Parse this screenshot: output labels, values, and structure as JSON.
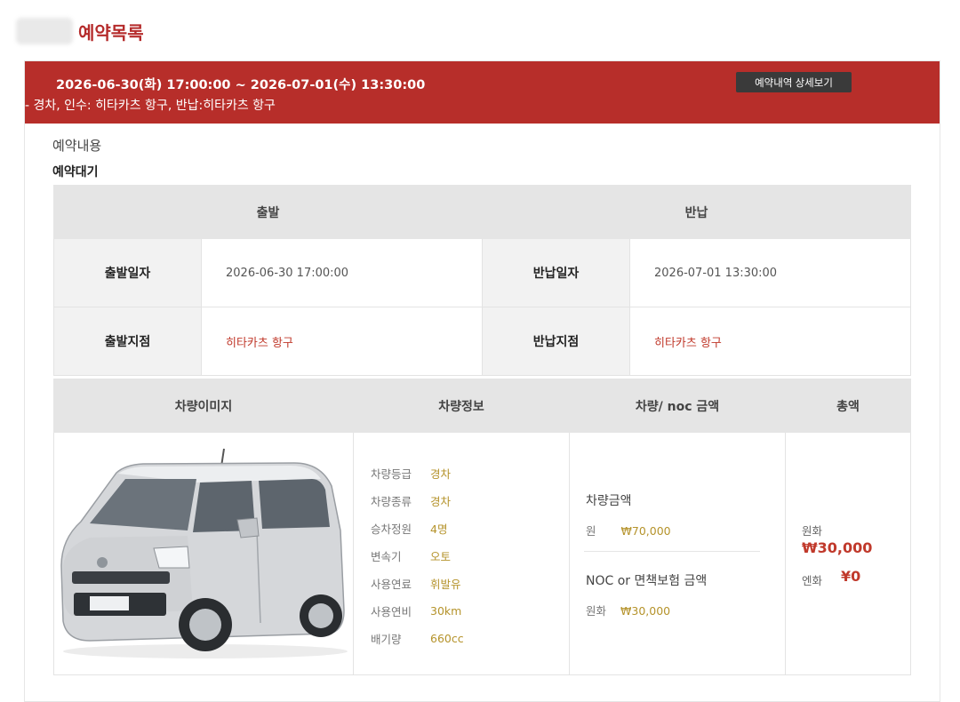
{
  "page": {
    "title": "예약목록"
  },
  "reservation": {
    "period": "2026-06-30(화) 17:00:00 ~ 2026-07-01(수) 13:30:00",
    "summary": "- 경차, 인수: 히타카츠 항구, 반납:히타카츠 항구",
    "detail_button": "예약내역 상세보기",
    "section_label": "예약내용",
    "status": "예약대기"
  },
  "schedule": {
    "departure_header": "출발",
    "return_header": "반납",
    "rows": [
      {
        "dep_label": "출발일자",
        "dep_value": "2026-06-30 17:00:00",
        "ret_label": "반납일자",
        "ret_value": "2026-07-01 13:30:00"
      },
      {
        "dep_label": "출발지점",
        "dep_value": "히타카츠 항구",
        "ret_label": "반납지점",
        "ret_value": "히타카츠 항구"
      }
    ]
  },
  "car_table": {
    "headers": [
      "차량이미지",
      "차량정보",
      "차량/ noc 금액",
      "총액"
    ],
    "info": [
      {
        "k": "차량등급",
        "v": "경차"
      },
      {
        "k": "차량종류",
        "v": "경차"
      },
      {
        "k": "승차정원",
        "v": "4명"
      },
      {
        "k": "변속기",
        "v": "오토"
      },
      {
        "k": "사용연료",
        "v": "휘발유"
      },
      {
        "k": "사용연비",
        "v": "30km"
      },
      {
        "k": "배기량",
        "v": "660cc"
      }
    ],
    "car_price_title": "차량금액",
    "car_price_label": "원",
    "car_price_value": "₩70,000",
    "noc_title": "NOC or 면책보험 금액",
    "noc_label": "원화",
    "noc_value": "₩30,000",
    "total_krw_label": "원화",
    "total_krw_value": "₩30,000",
    "total_jpy_label": "엔화",
    "total_jpy_value": "¥0"
  },
  "colors": {
    "accent": "#b72e2a",
    "gold": "#b5932b",
    "red_text": "#c0392b"
  },
  "icons": {
    "car_image": "car-photo-suzuki-wagonr"
  }
}
